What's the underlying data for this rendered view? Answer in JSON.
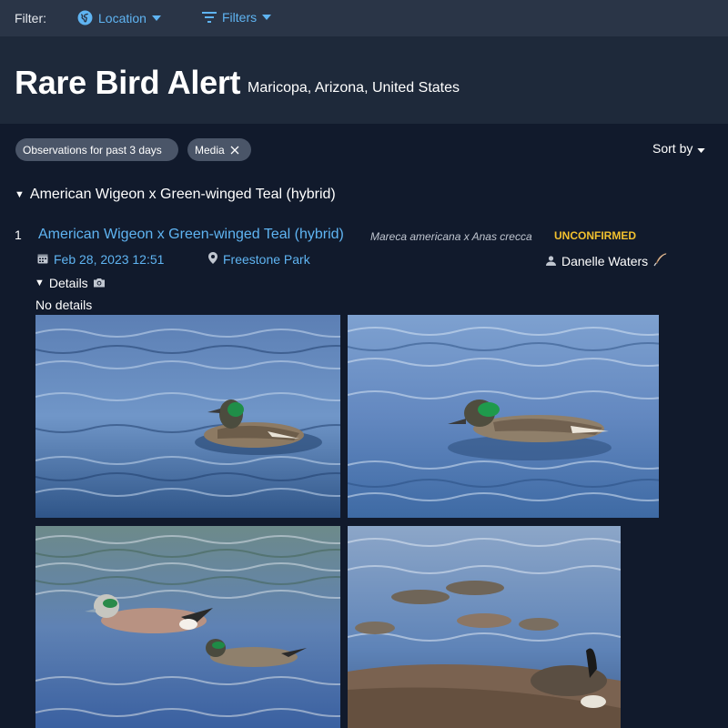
{
  "filterbar": {
    "label": "Filter:",
    "location_label": "Location",
    "filters_label": "Filters"
  },
  "header": {
    "title": "Rare Bird Alert",
    "region": "Maricopa, Arizona, United States"
  },
  "chips": {
    "period": "Observations for past 3 days",
    "media": "Media"
  },
  "sort_label": "Sort by",
  "group": {
    "title": "American Wigeon x Green-winged Teal (hybrid)"
  },
  "observation": {
    "index": "1",
    "common_name": "American Wigeon x Green-winged Teal (hybrid)",
    "scientific_name": "Mareca americana x Anas crecca",
    "status": "UNCONFIRMED",
    "date": "Feb 28, 2023 12:51",
    "location": "Freestone Park",
    "observer": "Danelle Waters",
    "details_label": "Details",
    "details_text": "No details"
  },
  "icons": {
    "location": "globe-icon",
    "filters": "filter-icon",
    "date": "calendar-icon",
    "place": "map-pin-icon",
    "observer": "person-icon",
    "observer_badge": "feather-icon",
    "details": "camera-icon"
  },
  "colors": {
    "link": "#5fb4f2",
    "status": "#f2c12e",
    "background": "#111a2c",
    "header": "#1e293a",
    "filterbar": "#2a3547"
  },
  "photos": {
    "count": 4
  }
}
